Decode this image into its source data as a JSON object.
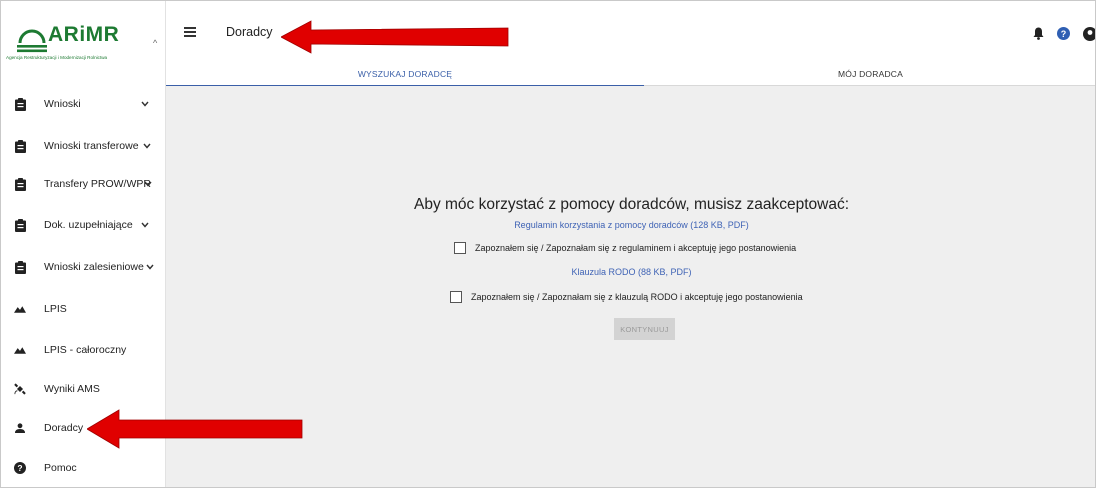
{
  "logo": {
    "name": "ARiMR",
    "subtitle": "Agencja Restrukturyzacji i Modernizacji Rolnictwa"
  },
  "sidebar": {
    "items": [
      {
        "label": "Wnioski",
        "icon": "clipboard-icon",
        "has_chevron": true
      },
      {
        "label": "Wnioski transferowe",
        "icon": "clipboard-icon",
        "has_chevron": true
      },
      {
        "label": "Transfery PROW/WPR",
        "icon": "clipboard-icon",
        "has_chevron": true
      },
      {
        "label": "Dok. uzupełniające",
        "icon": "clipboard-icon",
        "has_chevron": true
      },
      {
        "label": "Wnioski zalesieniowe",
        "icon": "clipboard-icon",
        "has_chevron": true
      },
      {
        "label": "LPIS",
        "icon": "terrain-icon",
        "has_chevron": false
      },
      {
        "label": "LPIS - całoroczny",
        "icon": "terrain-icon",
        "has_chevron": false
      },
      {
        "label": "Wyniki AMS",
        "icon": "satellite-icon",
        "has_chevron": false
      },
      {
        "label": "Doradcy",
        "icon": "person-icon",
        "has_chevron": false
      },
      {
        "label": "Pomoc",
        "icon": "help-circle-icon",
        "has_chevron": false
      }
    ]
  },
  "header": {
    "title": "Doradcy",
    "tabs": [
      {
        "label": "WYSZUKAJ DORADCĘ",
        "active": true
      },
      {
        "label": "MÓJ DORADCA",
        "active": false
      }
    ],
    "icons": [
      "bell-icon",
      "help-circle-icon",
      "account-icon"
    ]
  },
  "main": {
    "heading": "Aby móc korzystać z pomocy doradców, musisz zaakceptować:",
    "regulations_link": "Regulamin korzystania z pomocy doradców (128 KB, PDF)",
    "regulations_checkbox": "Zapoznałem się / Zapoznałam się z regulaminem i akceptuję jego postanowienia",
    "rodo_link": "Klauzula RODO (88 KB, PDF)",
    "rodo_checkbox": "Zapoznałem się / Zapoznałam się z klauzulą RODO i akceptuję jego postanowienia",
    "continue_button": "KONTYNUUJ"
  },
  "colors": {
    "brand_green": "#1d7a32",
    "accent_blue": "#3a5fa8",
    "link_blue": "#3f63b5",
    "content_bg": "#efefef",
    "annotation_red": "#e00000"
  }
}
